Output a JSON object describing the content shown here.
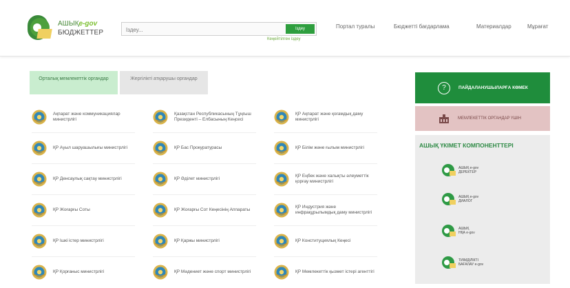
{
  "header": {
    "logo_line1_a": "АШЫҚ",
    "logo_line1_b": "e-gov",
    "logo_line2": "БЮДЖЕТТЕР",
    "search_placeholder": "Іздеу...",
    "search_button": "Іздеу",
    "advanced_search": "Кеңейтілген іздеу",
    "nav": [
      "Портал туралы",
      "Бюджетті бағдарлама",
      "Материалдар",
      "Мұрағат"
    ]
  },
  "tabs": {
    "active": "Орталық мемлекеттік органдар",
    "inactive": "Жергілікті атқарушы органдар"
  },
  "organizations": [
    [
      "Ақпарат және коммуникациялар министрлігі",
      "Қазақстан Республикасының Тұңғыш Президенті – Елбасының Кеңсесі",
      "ҚР Ақпарат және қоғамдық даму министрлігі"
    ],
    [
      "ҚР Ауыл шаруашылығы министрлігі",
      "ҚР Бас Прокуратурасы",
      "ҚР Білім және ғылым министрлігі"
    ],
    [
      "ҚР Денсаулық сақтау министрлігі",
      "ҚР Әділет министрлігі",
      "ҚР Еңбек және халықты әлеуметтік қорғау министрлігі"
    ],
    [
      "ҚР Жоғарғы Соты",
      "ҚР Жоғарғы Сот Кеңесінің Аппараты",
      "ҚР Индустрия және инфрақұрылымдық даму министрлігі"
    ],
    [
      "ҚР Ішкі істер министрлігі",
      "ҚР Қаржы министрлігі",
      "ҚР Конституциялық Кеңесі"
    ],
    [
      "ҚР Қорғаныс министрлігі",
      "ҚР Мәдениет және спорт министрлігі",
      "ҚР Мемлекеттік қызмет істері агенттігі"
    ]
  ],
  "sidebar": {
    "help_label": "ПАЙДАЛАНУШЫЛАРҒА КӨМЕК",
    "gov_label": "МЕМЛЕКЕТТІК ОРГАНДАР ҮШІН",
    "components_title": "АШЫҚ ҮКІМЕТ КОМПОНЕНТТЕРІ",
    "components": [
      {
        "line1": "АШЫҚ e-gov",
        "line2": "ДЕРЕКТЕР"
      },
      {
        "line1": "АШЫҚ e-gov",
        "line2": "ДИАЛОГ"
      },
      {
        "line1": "АШЫҚ",
        "line2": "НҚА e-gov"
      },
      {
        "line1": "ТИІМДІЛІКТІ",
        "line2": "БАҒАЛАУ e-gov"
      }
    ]
  },
  "colors": {
    "primary_green": "#1f8d3c",
    "light_green_tab": "#c9edcf",
    "pink_button": "#e3c3c3",
    "panel_grey": "#ececec"
  }
}
